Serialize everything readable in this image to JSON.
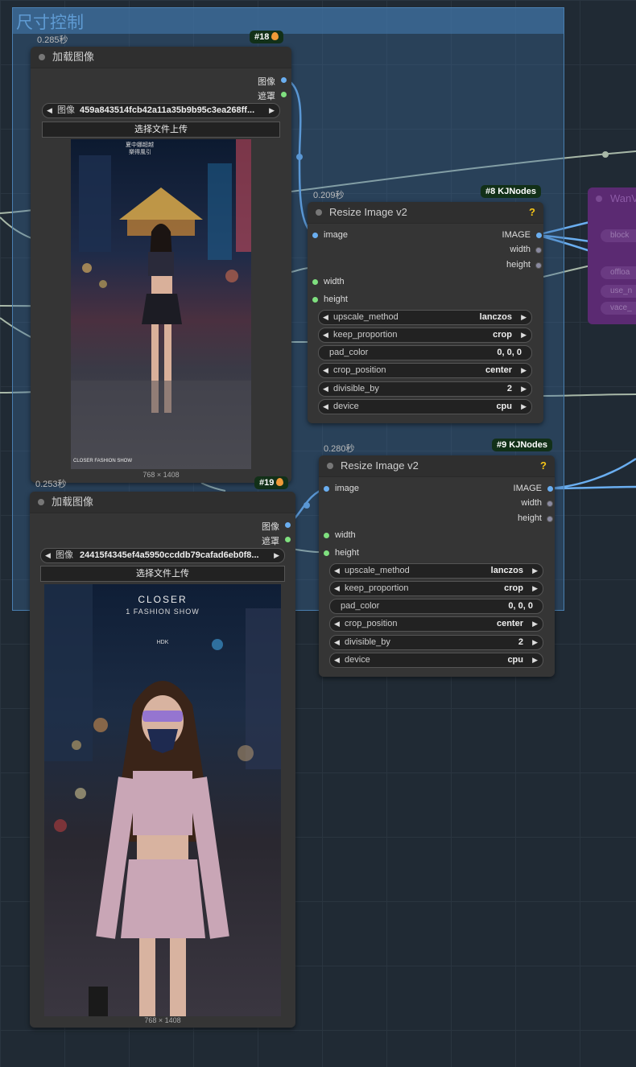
{
  "group": {
    "title": "尺寸控制"
  },
  "load_image_1": {
    "timing": "0.285秒",
    "badge": "#18",
    "title": "加载图像",
    "outputs": [
      "图像",
      "遮罩"
    ],
    "image_combo": {
      "label": "图像",
      "value": "459a843514fcb42a11a35b9b95c3ea268ff..."
    },
    "upload_label": "选择文件上传",
    "dims": "768 × 1408",
    "poster_texts": [
      "夏中娜超越",
      "樂得風引",
      "CLOSER FASHION SHOW"
    ]
  },
  "load_image_2": {
    "timing": "0.253秒",
    "badge": "#19",
    "title": "加载图像",
    "outputs": [
      "图像",
      "遮罩"
    ],
    "image_combo": {
      "label": "图像",
      "value": "24415f4345ef4a5950ccddb79cafad6eb0f8..."
    },
    "upload_label": "选择文件上传",
    "dims": "768 × 1408",
    "poster_texts": [
      "CLOSER",
      "1 FASHION SHOW",
      "HDK"
    ]
  },
  "resize_8": {
    "timing": "0.209秒",
    "badge": "#8 KJNodes",
    "title": "Resize Image v2",
    "help": "?",
    "inputs": [
      "image",
      "width",
      "height"
    ],
    "outputs": [
      "IMAGE",
      "width",
      "height"
    ],
    "widgets": [
      {
        "label": "upscale_method",
        "value": "lanczos"
      },
      {
        "label": "keep_proportion",
        "value": "crop"
      },
      {
        "label": "pad_color",
        "value": "0, 0, 0"
      },
      {
        "label": "crop_position",
        "value": "center"
      },
      {
        "label": "divisible_by",
        "value": "2"
      },
      {
        "label": "device",
        "value": "cpu"
      }
    ]
  },
  "resize_9": {
    "timing": "0.280秒",
    "badge": "#9 KJNodes",
    "title": "Resize Image v2",
    "help": "?",
    "inputs": [
      "image",
      "width",
      "height"
    ],
    "outputs": [
      "IMAGE",
      "width",
      "height"
    ],
    "widgets": [
      {
        "label": "upscale_method",
        "value": "lanczos"
      },
      {
        "label": "keep_proportion",
        "value": "crop"
      },
      {
        "label": "pad_color",
        "value": "0, 0, 0"
      },
      {
        "label": "crop_position",
        "value": "center"
      },
      {
        "label": "divisible_by",
        "value": "2"
      },
      {
        "label": "device",
        "value": "cpu"
      }
    ]
  },
  "side_node": {
    "title": "WanV",
    "widgets": [
      "block",
      "offloa",
      "use_n",
      "vace_"
    ]
  },
  "colors": {
    "link_blue": "#6aaef0",
    "link_grey": "#a8b8a8",
    "green_slot": "#7fe07f",
    "help": "#f5c518"
  }
}
